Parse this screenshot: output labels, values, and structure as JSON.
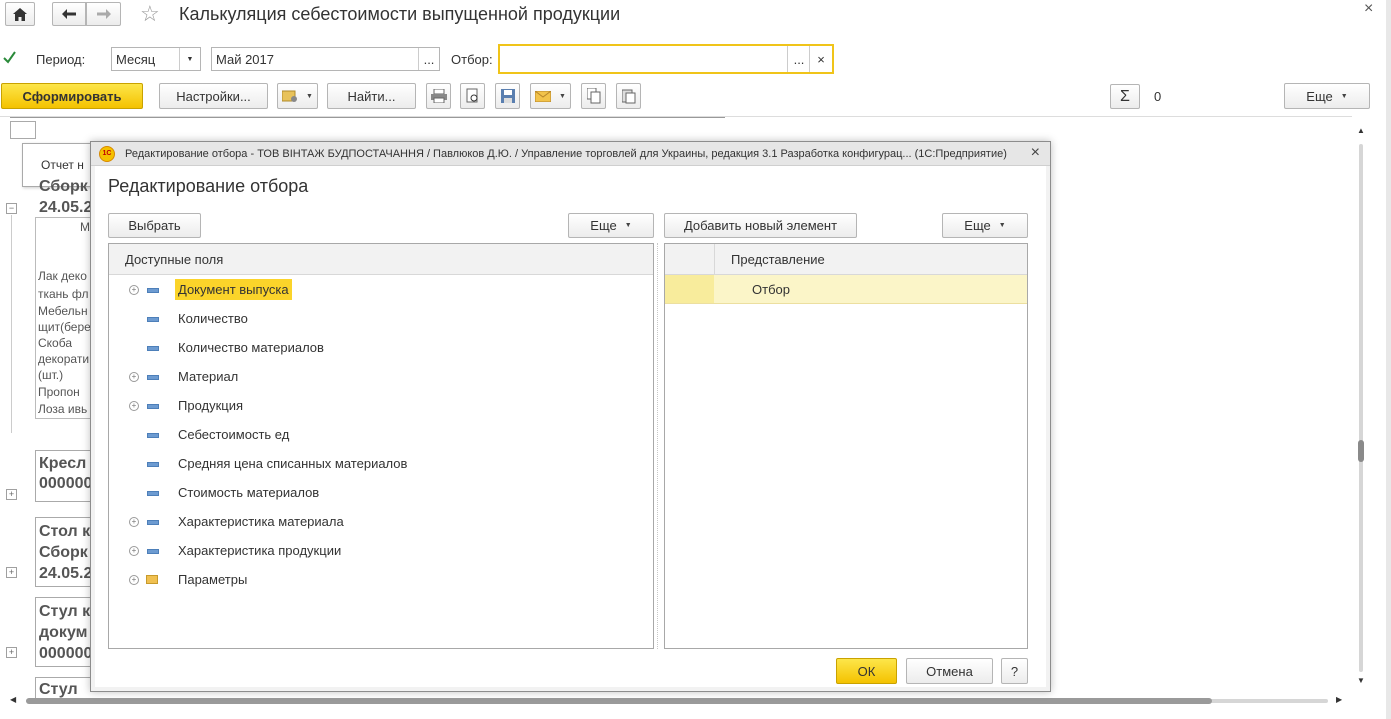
{
  "window": {
    "title": "Калькуляция себестоимости выпущенной продукции",
    "home_icon": "home-icon",
    "back_icon": "arrow-left-icon",
    "forward_icon": "arrow-right-icon",
    "star_icon": "star-icon",
    "close_label": "×"
  },
  "filters": {
    "period_checked": true,
    "period_label": "Период:",
    "period_type": "Месяц",
    "period_value": "Май 2017",
    "ellipsis": "...",
    "filter_label": "Отбор:",
    "filter_value": "",
    "clear_label": "×"
  },
  "toolbar": {
    "generate": "Сформировать",
    "settings": "Настройки...",
    "find": "Найти...",
    "sum_value": "0",
    "more": "Еще"
  },
  "background_report": {
    "report_tab": "Отчет н",
    "rows_bold": [
      "Сборк",
      "24.05.2"
    ],
    "m_label": "М",
    "materials": [
      "Лак деко",
      "ткань фл",
      "Мебельн",
      "щит(бере",
      "Скоба",
      "декорати",
      "(шт.)",
      "Пропон",
      "Лоза ивь"
    ],
    "groups": [
      [
        "Кресл",
        "000000"
      ],
      [
        "Стол к",
        "Сборк",
        "24.05.2"
      ],
      [
        "Стул к",
        "докум",
        "000000"
      ],
      [
        "Стул"
      ]
    ]
  },
  "dialog": {
    "titlebar": "Редактирование отбора - ТОВ ВІНТАЖ БУДПОСТАЧАННЯ / Павлюков Д.Ю. / Управление торговлей для Украины, редакция 3.1 Разработка конфигурац...  (1С:Предприятие)",
    "logo": "1С",
    "heading": "Редактирование отбора",
    "select_button": "Выбрать",
    "more_left": "Еще",
    "add_button": "Добавить новый элемент",
    "more_right": "Еще",
    "left_header": "Доступные поля",
    "fields": [
      {
        "label": "Документ выпуска",
        "expandable": true,
        "icon": "field-icon",
        "selected": true
      },
      {
        "label": "Количество",
        "expandable": false,
        "icon": "field-icon",
        "selected": false
      },
      {
        "label": "Количество материалов",
        "expandable": false,
        "icon": "field-icon",
        "selected": false
      },
      {
        "label": "Материал",
        "expandable": true,
        "icon": "field-icon",
        "selected": false
      },
      {
        "label": "Продукция",
        "expandable": true,
        "icon": "field-icon",
        "selected": false
      },
      {
        "label": "Себестоимость ед",
        "expandable": false,
        "icon": "field-icon",
        "selected": false
      },
      {
        "label": "Средняя цена списанных материалов",
        "expandable": false,
        "icon": "field-icon",
        "selected": false
      },
      {
        "label": "Стоимость материалов",
        "expandable": false,
        "icon": "field-icon",
        "selected": false
      },
      {
        "label": "Характеристика материала",
        "expandable": true,
        "icon": "field-icon",
        "selected": false
      },
      {
        "label": "Характеристика продукции",
        "expandable": true,
        "icon": "field-icon",
        "selected": false
      },
      {
        "label": "Параметры",
        "expandable": true,
        "icon": "folder-icon",
        "selected": false
      }
    ],
    "right_header": "Представление",
    "right_row": "Отбор",
    "ok": "ОК",
    "cancel": "Отмена",
    "help": "?"
  },
  "colors": {
    "accent_yellow": "#f7d117",
    "selection": "#fbd42a",
    "row_highlight": "#fbf5c8",
    "filter_border": "#f0c419"
  }
}
